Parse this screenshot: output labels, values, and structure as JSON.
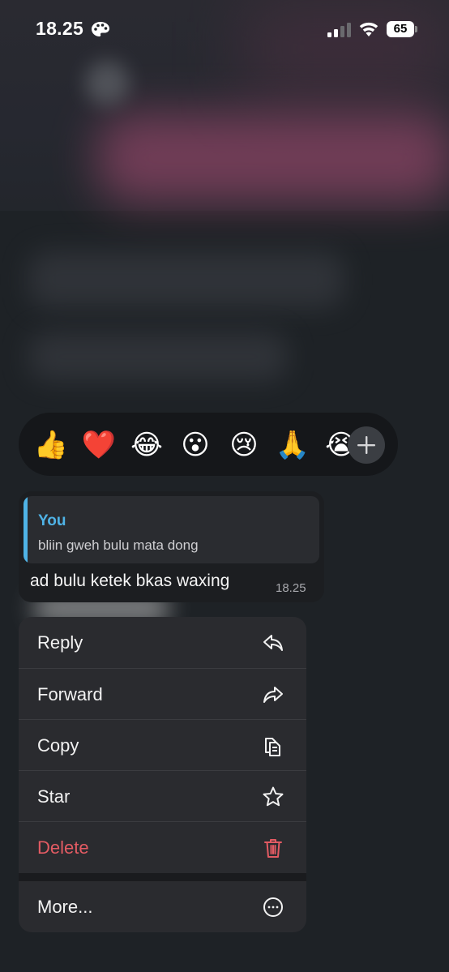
{
  "status_bar": {
    "time": "18.25",
    "battery": "65"
  },
  "reactions": {
    "emojis": [
      "👍",
      "❤️",
      "😂",
      "😮",
      "😢",
      "🙏",
      "😭"
    ],
    "more_label": "+"
  },
  "message": {
    "quote_author": "You",
    "quote_text": "bliin gweh bulu mata dong",
    "text": "ad bulu ketek bkas waxing",
    "time": "18.25"
  },
  "menu": {
    "reply": "Reply",
    "forward": "Forward",
    "copy": "Copy",
    "star": "Star",
    "delete": "Delete",
    "more": "More..."
  },
  "colors": {
    "accent_blue": "#4fb3e6",
    "destructive": "#e35b63",
    "menu_bg": "#2a2b2f"
  }
}
